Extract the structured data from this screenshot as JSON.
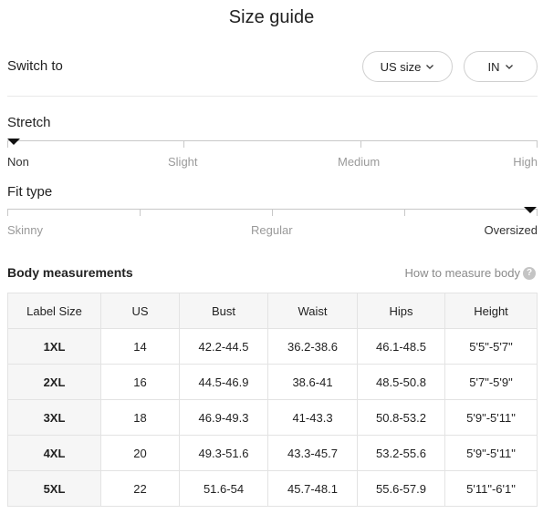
{
  "page": {
    "title": "Size guide"
  },
  "switch": {
    "label": "Switch to",
    "size_value": "US size",
    "unit_value": "IN"
  },
  "stretch": {
    "title": "Stretch",
    "labels": [
      "Non",
      "Slight",
      "Medium",
      "High"
    ],
    "selected": "Non"
  },
  "fit": {
    "title": "Fit type",
    "labels": [
      "Skinny",
      "Regular",
      "Oversized"
    ],
    "selected": "Oversized"
  },
  "body_measurements": {
    "title": "Body measurements",
    "how_to_link": "How to measure body",
    "help_icon": "question-circle-icon",
    "headers": [
      "Label Size",
      "US",
      "Bust",
      "Waist",
      "Hips",
      "Height"
    ],
    "rows": [
      [
        "1XL",
        "14",
        "42.2-44.5",
        "36.2-38.6",
        "46.1-48.5",
        "5'5\"-5'7\""
      ],
      [
        "2XL",
        "16",
        "44.5-46.9",
        "38.6-41",
        "48.5-50.8",
        "5'7\"-5'9\""
      ],
      [
        "3XL",
        "18",
        "46.9-49.3",
        "41-43.3",
        "50.8-53.2",
        "5'9\"-5'11\""
      ],
      [
        "4XL",
        "20",
        "49.3-51.6",
        "43.3-45.7",
        "53.2-55.6",
        "5'9\"-5'11\""
      ],
      [
        "5XL",
        "22",
        "51.6-54",
        "45.7-48.1",
        "55.6-57.9",
        "5'11\"-6'1\""
      ]
    ]
  }
}
